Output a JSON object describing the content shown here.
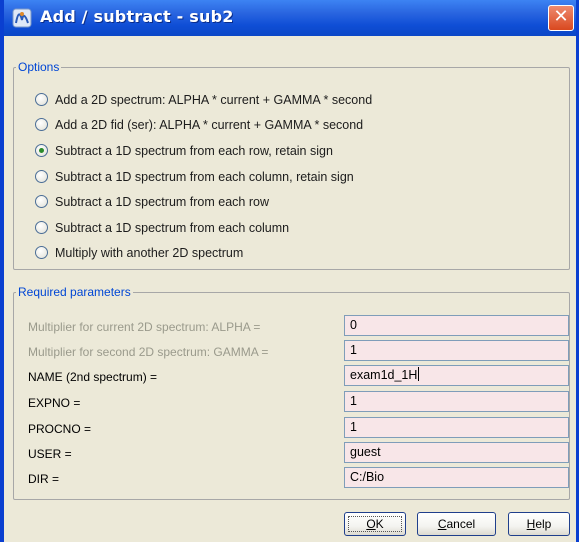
{
  "window": {
    "title": "Add / subtract - sub2",
    "close_label": "✕",
    "icon": "topspin-app-icon"
  },
  "options": {
    "legend": "Options",
    "selected_index": 2,
    "items": [
      {
        "label": "Add a 2D spectrum: ALPHA * current + GAMMA * second",
        "selected": false
      },
      {
        "label": "Add a 2D fid (ser): ALPHA * current + GAMMA * second",
        "selected": false
      },
      {
        "label": "Subtract a 1D spectrum from each row, retain sign",
        "selected": true
      },
      {
        "label": "Subtract a 1D spectrum from each column, retain sign",
        "selected": false
      },
      {
        "label": "Subtract a 1D spectrum from each row",
        "selected": false
      },
      {
        "label": "Subtract a 1D spectrum from each column",
        "selected": false
      },
      {
        "label": "Multiply with another 2D spectrum",
        "selected": false
      }
    ]
  },
  "params": {
    "legend": "Required parameters",
    "rows": [
      {
        "label": "Multiplier for current 2D spectrum: ALPHA =",
        "value": "0",
        "disabled": true
      },
      {
        "label": "Multiplier for second 2D spectrum: GAMMA =",
        "value": "1",
        "disabled": true
      },
      {
        "label": "NAME (2nd spectrum) =",
        "value": "exam1d_1H",
        "disabled": false
      },
      {
        "label": "EXPNO =",
        "value": "1",
        "disabled": false
      },
      {
        "label": "PROCNO =",
        "value": "1",
        "disabled": false
      },
      {
        "label": "USER =",
        "value": "guest",
        "disabled": false
      },
      {
        "label": "DIR =",
        "value": "C:/Bio",
        "disabled": false
      }
    ]
  },
  "buttons": {
    "ok": {
      "mnemonic": "O",
      "rest": "K"
    },
    "cancel": {
      "mnemonic": "C",
      "rest": "ancel"
    },
    "help": {
      "mnemonic": "H",
      "rest": "elp"
    }
  },
  "colors": {
    "titlebar": "#0f4ed6",
    "legend": "#0046d5",
    "input_bg": "#f8e6e8",
    "close": "#d9481f"
  }
}
